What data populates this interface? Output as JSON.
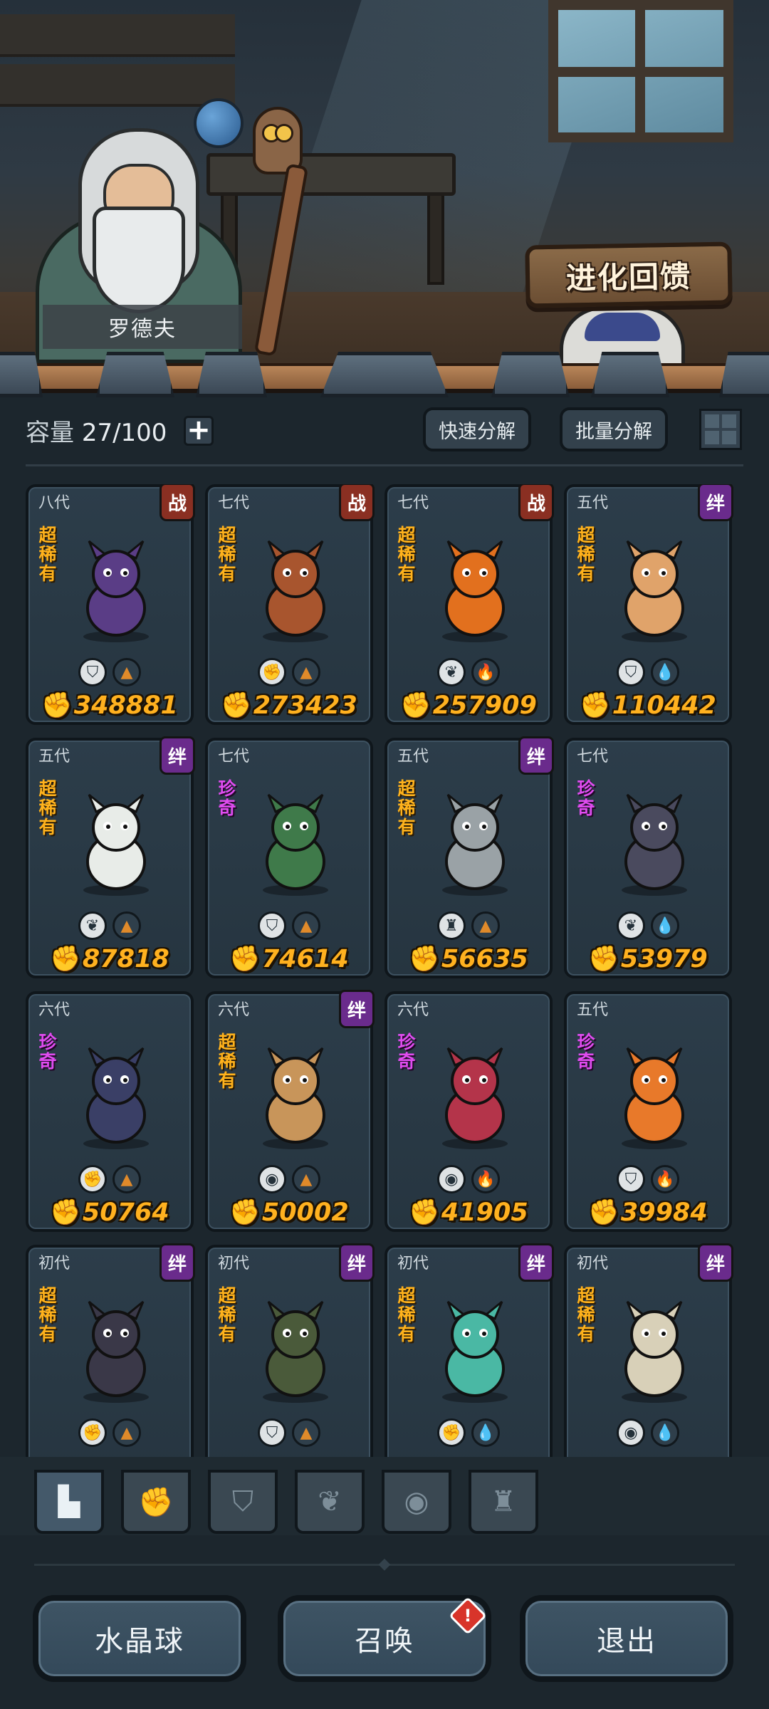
{
  "scene": {
    "npc_name": "罗德夫",
    "evolve_sign": "进化回馈"
  },
  "capacity": {
    "label": "容量",
    "value": "27/100",
    "add_icon": "plus-icon"
  },
  "toolbar": {
    "quick_decompose": "快速分解",
    "batch_decompose": "批量分解",
    "view_toggle_icon": "grid-view-icon"
  },
  "monsters": [
    {
      "gen": "八代",
      "tag": "战",
      "tag_kind": "war",
      "rarity": "超稀有",
      "rarity_kind": "sr",
      "type_icon": "shield-icon",
      "element_icon": "earth-icon",
      "power": "348881",
      "color": "#5a3d86"
    },
    {
      "gen": "七代",
      "tag": "战",
      "tag_kind": "war",
      "rarity": "超稀有",
      "rarity_kind": "sr",
      "type_icon": "fist-icon",
      "element_icon": "earth-icon",
      "power": "273423",
      "color": "#a8552e"
    },
    {
      "gen": "七代",
      "tag": "战",
      "tag_kind": "war",
      "rarity": "超稀有",
      "rarity_kind": "sr",
      "type_icon": "leaf-icon",
      "element_icon": "fire-icon",
      "power": "257909",
      "color": "#e2701e"
    },
    {
      "gen": "五代",
      "tag": "绊",
      "tag_kind": "bond",
      "rarity": "超稀有",
      "rarity_kind": "sr",
      "type_icon": "shield-icon",
      "element_icon": "water-icon",
      "power": "110442",
      "color": "#e0a36a"
    },
    {
      "gen": "五代",
      "tag": "绊",
      "tag_kind": "bond",
      "rarity": "超稀有",
      "rarity_kind": "sr",
      "type_icon": "leaf-icon",
      "element_icon": "earth-icon",
      "power": "87818",
      "color": "#e8ece8"
    },
    {
      "gen": "七代",
      "tag": "",
      "tag_kind": "",
      "rarity": "珍奇",
      "rarity_kind": "rare",
      "type_icon": "shield-icon",
      "element_icon": "earth-icon",
      "power": "74614",
      "color": "#3f7a4a"
    },
    {
      "gen": "五代",
      "tag": "绊",
      "tag_kind": "bond",
      "rarity": "超稀有",
      "rarity_kind": "sr",
      "type_icon": "tower-icon",
      "element_icon": "earth-icon",
      "power": "56635",
      "color": "#9aa2a6"
    },
    {
      "gen": "七代",
      "tag": "",
      "tag_kind": "",
      "rarity": "珍奇",
      "rarity_kind": "rare",
      "type_icon": "leaf-icon",
      "element_icon": "water-icon",
      "power": "53979",
      "color": "#4a4a5e"
    },
    {
      "gen": "六代",
      "tag": "",
      "tag_kind": "",
      "rarity": "珍奇",
      "rarity_kind": "rare",
      "type_icon": "fist-icon",
      "element_icon": "earth-icon",
      "power": "50764",
      "color": "#3a3f66"
    },
    {
      "gen": "六代",
      "tag": "绊",
      "tag_kind": "bond",
      "rarity": "超稀有",
      "rarity_kind": "sr",
      "type_icon": "alien-icon",
      "element_icon": "earth-icon",
      "power": "50002",
      "color": "#c8955a"
    },
    {
      "gen": "六代",
      "tag": "",
      "tag_kind": "",
      "rarity": "珍奇",
      "rarity_kind": "rare",
      "type_icon": "alien-icon",
      "element_icon": "fire-icon",
      "power": "41905",
      "color": "#b4344a"
    },
    {
      "gen": "五代",
      "tag": "",
      "tag_kind": "",
      "rarity": "珍奇",
      "rarity_kind": "rare",
      "type_icon": "shield-icon",
      "element_icon": "fire-icon",
      "power": "39984",
      "color": "#e8792a"
    },
    {
      "gen": "初代",
      "tag": "绊",
      "tag_kind": "bond",
      "rarity": "超稀有",
      "rarity_kind": "sr",
      "type_icon": "fist-icon",
      "element_icon": "earth-icon",
      "power": "",
      "color": "#3a3848"
    },
    {
      "gen": "初代",
      "tag": "绊",
      "tag_kind": "bond",
      "rarity": "超稀有",
      "rarity_kind": "sr",
      "type_icon": "shield-icon",
      "element_icon": "earth-icon",
      "power": "",
      "color": "#4a5a3a"
    },
    {
      "gen": "初代",
      "tag": "绊",
      "tag_kind": "bond",
      "rarity": "超稀有",
      "rarity_kind": "sr",
      "type_icon": "fist-icon",
      "element_icon": "water-icon",
      "power": "",
      "color": "#4ab8a4"
    },
    {
      "gen": "初代",
      "tag": "绊",
      "tag_kind": "bond",
      "rarity": "超稀有",
      "rarity_kind": "sr",
      "type_icon": "alien-icon",
      "element_icon": "water-icon",
      "power": "",
      "color": "#d8d0b8"
    }
  ],
  "filter_tabs": [
    {
      "icon": "all-blocks-icon",
      "active": true
    },
    {
      "icon": "fist-icon",
      "active": false
    },
    {
      "icon": "shield-icon",
      "active": false
    },
    {
      "icon": "leaf-icon",
      "active": false
    },
    {
      "icon": "alien-icon",
      "active": false
    },
    {
      "icon": "tower-icon",
      "active": false
    }
  ],
  "bottom_buttons": {
    "crystal": "水晶球",
    "summon": "召唤",
    "summon_alert": "!",
    "exit": "退出"
  },
  "colors": {
    "power_gold": "#ffb11f",
    "super_rare": "#ffb21c",
    "rare": "#e04cf0",
    "war_tag": "#8a2f22",
    "bond_tag": "#6a2b8c"
  }
}
